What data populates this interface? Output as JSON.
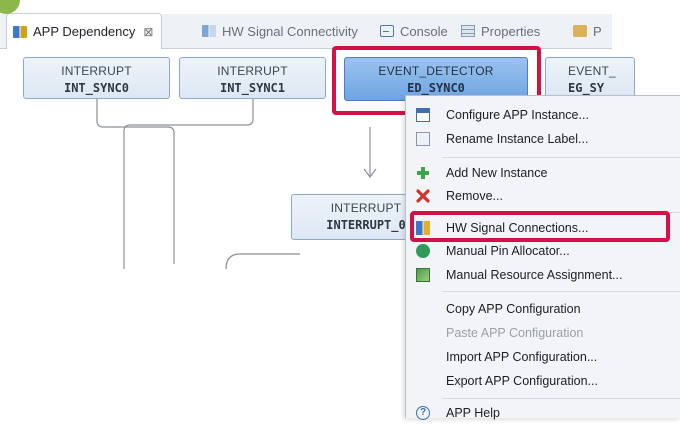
{
  "tabs": [
    {
      "label": "APP Dependency",
      "icon": "app-dependency-icon",
      "active": true
    },
    {
      "label": "HW Signal Connectivity",
      "icon": "hw-signal-icon",
      "active": false
    },
    {
      "label": "Console",
      "icon": "console-icon",
      "active": false
    },
    {
      "label": "Properties",
      "icon": "properties-icon",
      "active": false
    },
    {
      "label": "P",
      "icon": "problems-icon",
      "active": false
    }
  ],
  "tab_close_glyph": "⊠",
  "nodes": [
    {
      "type": "INTERRUPT",
      "name": "INT_SYNC0"
    },
    {
      "type": "INTERRUPT",
      "name": "INT_SYNC1"
    },
    {
      "type": "EVENT_DETECTOR",
      "name": "ED_SYNC0"
    },
    {
      "type": "EVENT_",
      "name": "EG_SY"
    },
    {
      "type": "INTERRUPT",
      "name": "INTERRUPT_0"
    }
  ],
  "context_menu": {
    "items": [
      {
        "label": "Configure APP Instance...",
        "icon": "configure-icon",
        "enabled": true
      },
      {
        "label": "Rename Instance Label...",
        "icon": "rename-icon",
        "enabled": true
      },
      {
        "label": "Add New Instance",
        "icon": "add-icon",
        "enabled": true
      },
      {
        "label": "Remove...",
        "icon": "remove-icon",
        "enabled": true
      },
      {
        "label": "HW Signal Connections...",
        "icon": "hw-signal-connections-icon",
        "enabled": true
      },
      {
        "label": "Manual Pin Allocator...",
        "icon": "pin-allocator-icon",
        "enabled": true
      },
      {
        "label": "Manual Resource Assignment...",
        "icon": "resource-assignment-icon",
        "enabled": true
      },
      {
        "label": "Copy APP Configuration",
        "icon": "",
        "enabled": true
      },
      {
        "label": "Paste APP Configuration",
        "icon": "",
        "enabled": false
      },
      {
        "label": "Import APP Configuration...",
        "icon": "",
        "enabled": true
      },
      {
        "label": "Export APP Configuration...",
        "icon": "",
        "enabled": true
      },
      {
        "label": "APP Help",
        "icon": "help-icon",
        "enabled": true
      }
    ]
  },
  "colors": {
    "highlight": "#d31145",
    "selected_node": "#7fb0e6",
    "node": "#e3ebf6"
  }
}
